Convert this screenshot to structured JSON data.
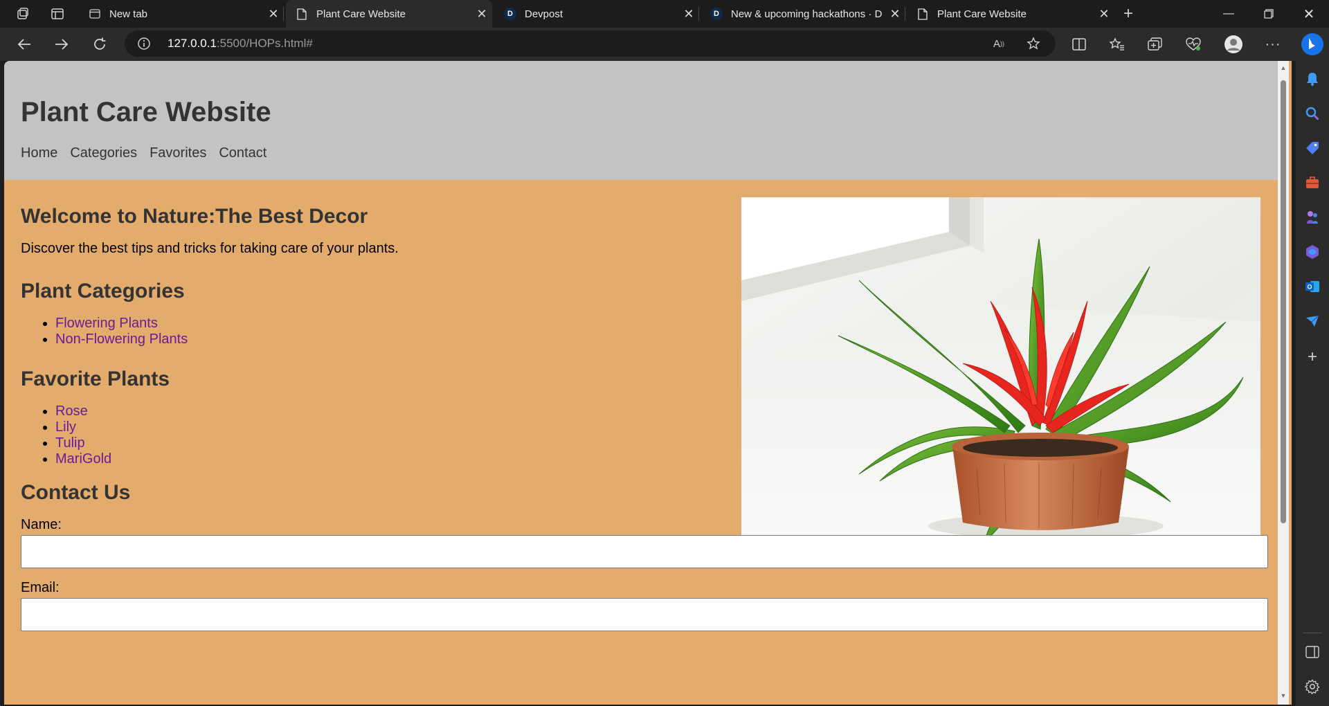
{
  "browser": {
    "tabs": [
      {
        "label": "New tab",
        "icon": "new-tab-icon",
        "active": false
      },
      {
        "label": "Plant Care Website",
        "icon": "page-icon",
        "active": true
      },
      {
        "label": "Devpost",
        "icon": "devpost-icon",
        "active": false
      },
      {
        "label": "New & upcoming hackathons · D",
        "icon": "devpost-icon",
        "active": false
      },
      {
        "label": "Plant Care Website",
        "icon": "page-icon",
        "active": false
      }
    ],
    "favicon_letter": "D",
    "url_host": "127.0.0.1",
    "url_rest": ":5500/HOPs.html#",
    "accent_color": "#1a73e8"
  },
  "site": {
    "title": "Plant Care Website",
    "nav": [
      "Home",
      "Categories",
      "Favorites",
      "Contact"
    ],
    "header_bg": "#c3c3c3",
    "body_bg": "#e3ab6c",
    "link_color": "#6a1b9a"
  },
  "welcome": {
    "heading": "Welcome to Nature:The Best Decor",
    "text": "Discover the best tips and tricks for taking care of your plants."
  },
  "categories": {
    "heading": "Plant Categories",
    "items": [
      "Flowering Plants",
      "Non-Flowering Plants"
    ]
  },
  "favorites": {
    "heading": "Favorite Plants",
    "items": [
      "Rose",
      "Lily",
      "Tulip",
      "MariGold"
    ]
  },
  "contact": {
    "heading": "Contact Us",
    "name_label": "Name:",
    "email_label": "Email:",
    "name_value": "",
    "email_value": ""
  },
  "hero_image": {
    "icon": "potted-bromeliad-photo"
  }
}
